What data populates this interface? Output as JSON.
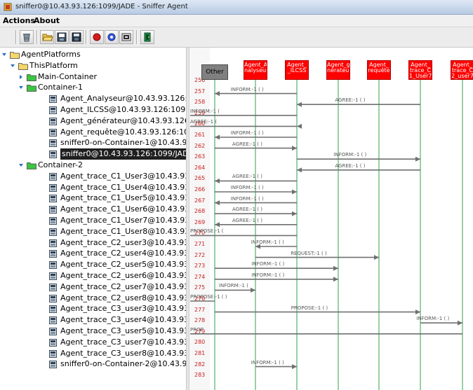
{
  "window": {
    "title": "sniffer0@10.43.93.126:1099/JADE - Sniffer Agent"
  },
  "menu": [
    {
      "label": "Actions"
    },
    {
      "label": "About"
    }
  ],
  "toolbar": {
    "icons": [
      "clear-canvas-icon",
      "open-folder-icon",
      "save-snapshot-icon",
      "save-icon",
      "record-icon",
      "display-icon",
      "filter-icon",
      "exit-door-icon"
    ]
  },
  "tree": {
    "root": "AgentPlatforms",
    "platform": "ThisPlatform",
    "main_container": "Main-Container",
    "container1": "Container-1",
    "container1_agents": [
      "Agent_Analyseur@10.43.93.126:1099",
      "Agent_ILCSS@10.43.93.126:1099/JA",
      "Agent_générateur@10.43.93.126:109",
      "Agent_requête@10.43.93.126:1099/J",
      "sniffer0-on-Container-1@10.43.93.12",
      "sniffer0@10.43.93.126:1099/JADE"
    ],
    "container2": "Container-2",
    "container2_agents": [
      "Agent_trace_C1_User3@10.43.93.12",
      "Agent_trace_C1_User4@10.43.93.12",
      "Agent_trace_C1_User5@10.43.93.12",
      "Agent_trace_C1_User6@10.43.93.12",
      "Agent_trace_C1_User7@10.43.93.12",
      "Agent_trace_C1_User8@10.43.93.12",
      "Agent_trace_C2_user3@10.43.93.12",
      "Agent_trace_C2_user4@10.43.93.12",
      "Agent_trace_C2_user5@10.43.93.12",
      "Agent_trace_C2_user6@10.43.93.12",
      "Agent_trace_C2_user7@10.43.93.12",
      "Agent_trace_C2_user8@10.43.93.12",
      "Agent_trace_C3_user3@10.43.93.12",
      "Agent_trace_C3_user4@10.43.93.12",
      "Agent_trace_C3_user5@10.43.93.12",
      "Agent_trace_C3_user7@10.43.93.12",
      "Agent_trace_C3_user8@10.43.93.12",
      "sniffer0-on-Container-2@10.43.93.12"
    ],
    "selected_agent": "sniffer0@10.43.93.126:1099/JADE"
  },
  "sniffer": {
    "agents": [
      {
        "label": "Other",
        "color": "#808080"
      },
      {
        "label": "Agent_A nalyseur",
        "color": "#ff0000"
      },
      {
        "label": "Agent_ _ILCSS",
        "color": "#ff0000"
      },
      {
        "label": "Agent_gé nérateur",
        "color": "#ff0000"
      },
      {
        "label": "Agent_ requête",
        "color": "#ff0000"
      },
      {
        "label": "Agent_ trace_C 1_User7",
        "color": "#ff0000"
      },
      {
        "label": "Agent_ trace_C 2_user7",
        "color": "#ff0000"
      }
    ],
    "line_numbers": [
      "256",
      "257",
      "258",
      "259",
      "260",
      "261",
      "262",
      "263",
      "264",
      "265",
      "266",
      "267",
      "268",
      "269",
      "270",
      "271",
      "272",
      "273",
      "274",
      "275",
      "276",
      "277",
      "278",
      "279",
      "280",
      "281",
      "282",
      "283"
    ],
    "messages": [
      {
        "row": 1,
        "from": 2,
        "to": 0,
        "label": "INFORM:-1 (     )"
      },
      {
        "row": 2,
        "from": 5,
        "to": 2,
        "label": "AGREE:-1 (     )"
      },
      {
        "row": 3,
        "from": 2,
        "to": 7,
        "label": "INFORM:-1 (  "
      },
      {
        "row": 4,
        "from": 7,
        "to": 2,
        "label": "AGREE:-1 (  "
      },
      {
        "row": 5,
        "from": 2,
        "to": 0,
        "label": "INFORM:-1 (     )"
      },
      {
        "row": 6,
        "from": 0,
        "to": 2,
        "label": "AGREE:-1 (     )"
      },
      {
        "row": 7,
        "from": 2,
        "to": 5,
        "label": "INFORM:-1 (     )"
      },
      {
        "row": 8,
        "from": 5,
        "to": 2,
        "label": "AGREE:-1 (     )"
      },
      {
        "row": 9,
        "from": 2,
        "to": 0,
        "label": "AGREE:-1 (     )"
      },
      {
        "row": 10,
        "from": 0,
        "to": 2,
        "label": "INFORM:-1 (     )"
      },
      {
        "row": 11,
        "from": 2,
        "to": 0,
        "label": "INFORM:-1 (     )"
      },
      {
        "row": 12,
        "from": 0,
        "to": 2,
        "label": "AGREE:-1 (     )"
      },
      {
        "row": 13,
        "from": 2,
        "to": 0,
        "label": "AGREE:-1 (     )"
      },
      {
        "row": 14,
        "from": 2,
        "to": 7,
        "label": "PROPOSE:-1 (  "
      },
      {
        "row": 15,
        "from": 2,
        "to": 1,
        "label": "INFORM:-1 (     )"
      },
      {
        "row": 16,
        "from": 1,
        "to": 4,
        "label": "REQUEST:-1 (     )"
      },
      {
        "row": 17,
        "from": 0,
        "to": 3,
        "label": "INFORM:-1 (     )"
      },
      {
        "row": 18,
        "from": 0,
        "to": 3,
        "label": "INFORM:-1 (     )"
      },
      {
        "row": 19,
        "from": 0,
        "to": 1,
        "label": "INFORM:-1 ("
      },
      {
        "row": 20,
        "from": 0,
        "to": 7,
        "label": "PROPOSE:-1 (     )"
      },
      {
        "row": 21,
        "from": 0,
        "to": 5,
        "label": "PROPOSE:-1 (     )"
      },
      {
        "row": 22,
        "from": 5,
        "to": 6,
        "label": "INFORM:-1 (     )"
      },
      {
        "row": 23,
        "from": 6,
        "to": 7,
        "label": "PROP"
      },
      {
        "row": 26,
        "from": 1,
        "to": 2,
        "label": "INFORM:-1 (     )"
      }
    ]
  }
}
